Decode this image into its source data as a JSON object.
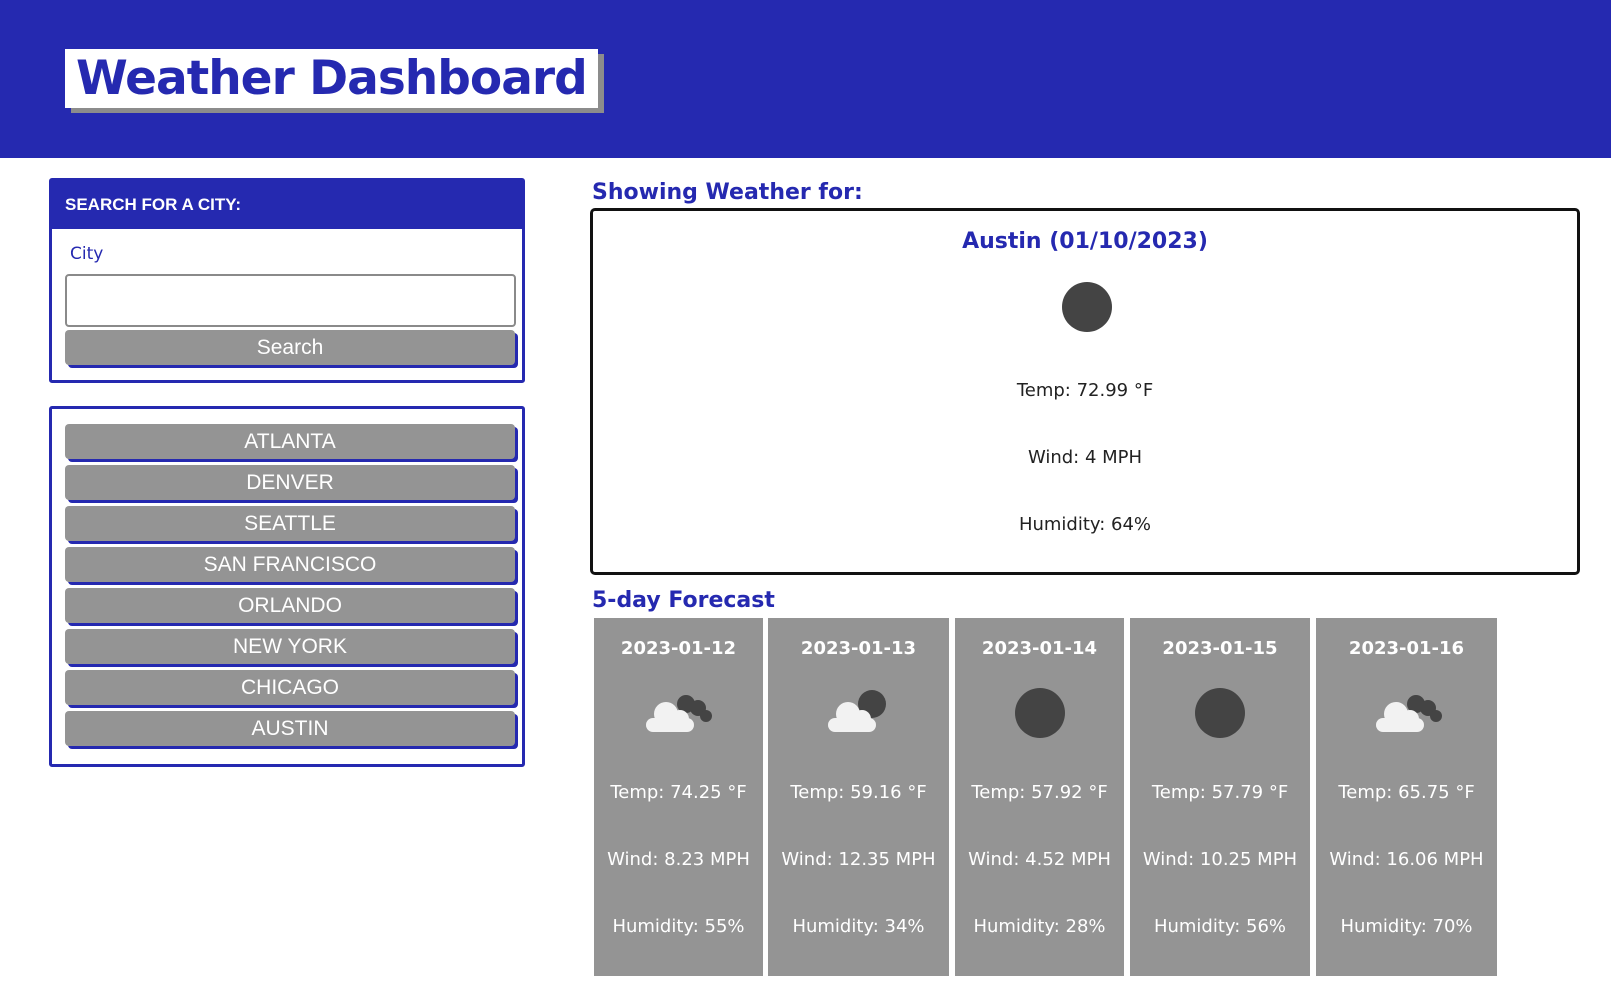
{
  "header": {
    "title": "Weather Dashboard"
  },
  "search": {
    "heading": "SEARCH FOR A CITY:",
    "city_label": "City",
    "input_value": "",
    "button_label": "Search"
  },
  "history": [
    "ATLANTA",
    "DENVER",
    "SEATTLE",
    "SAN FRANCISCO",
    "ORLANDO",
    "NEW YORK",
    "CHICAGO",
    "AUSTIN"
  ],
  "current": {
    "section_title": "Showing Weather for:",
    "city_date": "Austin (01/10/2023)",
    "icon": "moon-icon",
    "temp": "Temp: 72.99 °F",
    "wind": "Wind: 4 MPH",
    "humidity": "Humidity: 64%"
  },
  "forecast": {
    "section_title": "5-day Forecast",
    "days": [
      {
        "date": "2023-01-12",
        "icon": "night-cloudy-icon",
        "temp": "Temp: 74.25 °F",
        "wind": "Wind: 8.23 MPH",
        "humidity": "Humidity: 55%"
      },
      {
        "date": "2023-01-13",
        "icon": "cloud-moon-icon",
        "temp": "Temp: 59.16 °F",
        "wind": "Wind: 12.35 MPH",
        "humidity": "Humidity: 34%"
      },
      {
        "date": "2023-01-14",
        "icon": "moon-icon",
        "temp": "Temp: 57.92 °F",
        "wind": "Wind: 4.52 MPH",
        "humidity": "Humidity: 28%"
      },
      {
        "date": "2023-01-15",
        "icon": "moon-icon",
        "temp": "Temp: 57.79 °F",
        "wind": "Wind: 10.25 MPH",
        "humidity": "Humidity: 56%"
      },
      {
        "date": "2023-01-16",
        "icon": "night-cloudy-icon",
        "temp": "Temp: 65.75 °F",
        "wind": "Wind: 16.06 MPH",
        "humidity": "Humidity: 70%"
      }
    ]
  },
  "colors": {
    "brand": "#2529b0",
    "button": "#949494",
    "icon": "#444444"
  }
}
